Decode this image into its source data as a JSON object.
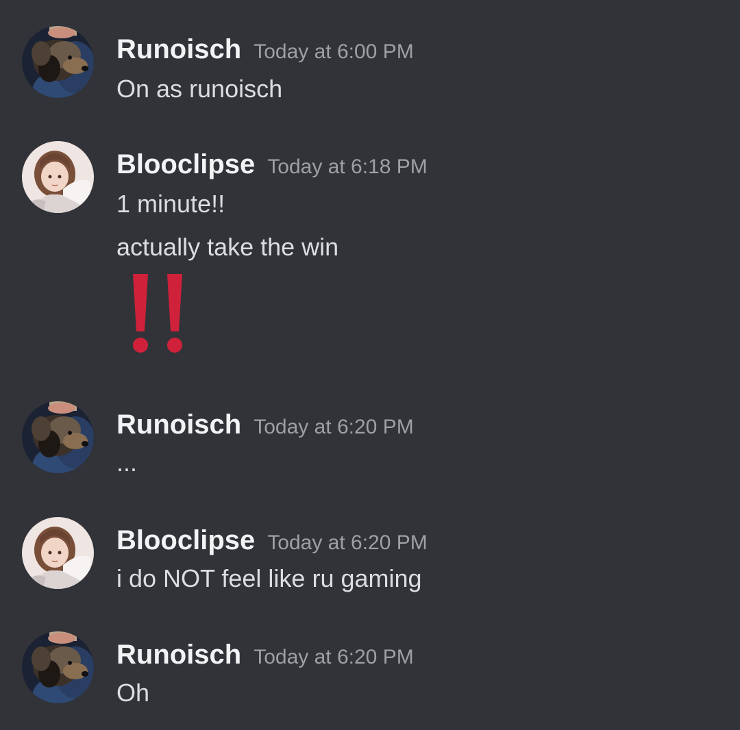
{
  "colors": {
    "background": "#313338",
    "username": "#f2f3f5",
    "timestamp": "#9ea0a6",
    "message_text": "#dbdee1",
    "emoji_red": "#d0213a"
  },
  "messages": [
    {
      "username": "Runoisch",
      "timestamp": "Today at 6:00 PM",
      "avatar": "dog-avatar-icon",
      "lines": [
        "On as runoisch"
      ]
    },
    {
      "username": "Blooclipse",
      "timestamp": "Today at 6:18 PM",
      "avatar": "anime-girl-avatar-icon",
      "lines": [
        "1 minute!!",
        "actually take the win"
      ],
      "emoji": "double-exclamation-emoji"
    },
    {
      "username": "Runoisch",
      "timestamp": "Today at 6:20 PM",
      "avatar": "dog-avatar-icon",
      "lines": [
        "..."
      ]
    },
    {
      "username": "Blooclipse",
      "timestamp": "Today at 6:20 PM",
      "avatar": "anime-girl-avatar-icon",
      "lines": [
        "i do NOT feel like ru gaming"
      ]
    },
    {
      "username": "Runoisch",
      "timestamp": "Today at 6:20 PM",
      "avatar": "dog-avatar-icon",
      "lines": [
        "Oh"
      ]
    }
  ]
}
